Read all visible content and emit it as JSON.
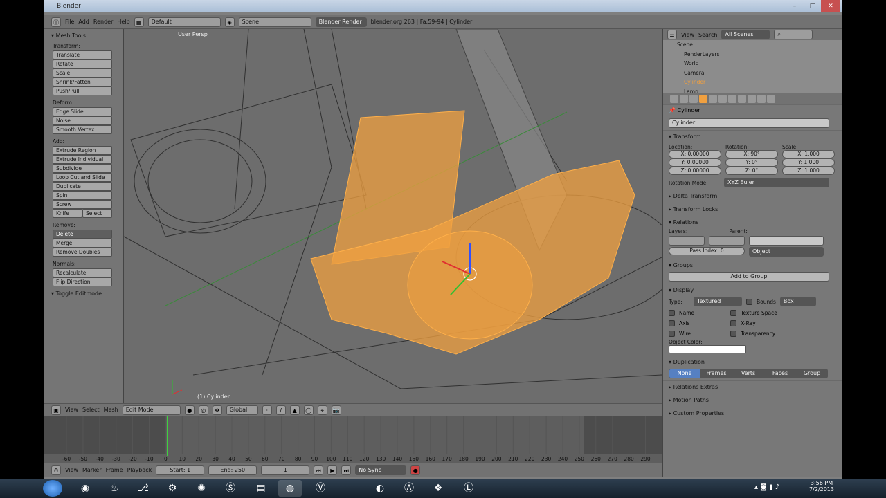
{
  "window": {
    "title": "Blender"
  },
  "infobar": {
    "menus": [
      "File",
      "Add",
      "Render",
      "Help"
    ],
    "layout": "Default",
    "scene": "Scene",
    "engine": "Blender Render",
    "stats": "blender.org 263 | Fa:59-94 | Cylinder"
  },
  "toolshelf": {
    "title": "Mesh Tools",
    "sections": [
      {
        "label": "Transform:",
        "buttons": [
          "Translate",
          "Rotate",
          "Scale",
          "Shrink/Fatten",
          "Push/Pull"
        ]
      },
      {
        "label": "Deform:",
        "buttons": [
          "Edge Slide",
          "Noise",
          "Smooth Vertex"
        ]
      },
      {
        "label": "Add:",
        "buttons": [
          "Extrude Region",
          "Extrude Individual",
          "Subdivide",
          "Loop Cut and Slide",
          "Duplicate",
          "Spin",
          "Screw"
        ]
      },
      {
        "label": "Remove:",
        "buttons": [
          "Delete",
          "Merge",
          "Remove Doubles"
        ]
      },
      {
        "label": "Normals:",
        "buttons": [
          "Recalculate",
          "Flip Direction"
        ]
      }
    ],
    "knife": "Knife",
    "select": "Select",
    "toggle": "Toggle Editmode"
  },
  "viewport": {
    "label": "User Persp",
    "object_label": "(1) Cylinder"
  },
  "view3d_header": {
    "menus": [
      "View",
      "Select",
      "Mesh"
    ],
    "mode": "Edit Mode",
    "orientation": "Global"
  },
  "timeline": {
    "ticks": [
      "-60",
      "-50",
      "-40",
      "-30",
      "-20",
      "-10",
      "0",
      "10",
      "20",
      "30",
      "40",
      "50",
      "60",
      "70",
      "80",
      "90",
      "100",
      "110",
      "120",
      "130",
      "140",
      "150",
      "160",
      "170",
      "180",
      "190",
      "200",
      "210",
      "220",
      "230",
      "240",
      "250",
      "260",
      "270",
      "280",
      "290"
    ],
    "current_frame": 0
  },
  "timeline_header": {
    "menus": [
      "View",
      "Marker",
      "Frame",
      "Playback"
    ],
    "start": "Start: 1",
    "end": "End: 250",
    "frame": "1",
    "sync": "No Sync"
  },
  "outliner": {
    "menus": [
      "View",
      "Search"
    ],
    "filter": "All Scenes",
    "items": [
      "Scene",
      "RenderLayers",
      "World",
      "Camera",
      "Cylinder",
      "Lamp"
    ]
  },
  "properties": {
    "object_path": "Cylinder",
    "object_name": "Cylinder",
    "transform": {
      "title": "Transform",
      "location_label": "Location:",
      "rotation_label": "Rotation:",
      "scale_label": "Scale:",
      "location": [
        "X: 0.00000",
        "Y: 0.00000",
        "Z: 0.00000"
      ],
      "rotation": [
        "X: 90°",
        "Y: 0°",
        "Z: 0°"
      ],
      "scale": [
        "X: 1.000",
        "Y: 1.000",
        "Z: 1.000"
      ],
      "rotation_mode_label": "Rotation Mode:",
      "rotation_mode": "XYZ Euler"
    },
    "delta": "Delta Transform",
    "locks": "Transform Locks",
    "relations": {
      "title": "Relations",
      "layers": "Layers:",
      "parent": "Parent:",
      "parent_type": "Object",
      "pass_index": "Pass Index: 0"
    },
    "groups": {
      "title": "Groups",
      "add": "Add to Group"
    },
    "display": {
      "title": "Display",
      "type_label": "Type:",
      "type": "Textured",
      "bounds": "Bounds",
      "bounds_type": "Box",
      "checks_left": [
        "Name",
        "Axis",
        "Wire"
      ],
      "checks_right": [
        "Texture Space",
        "X-Ray",
        "Transparency"
      ],
      "object_color": "Object Color:"
    },
    "duplication": {
      "title": "Duplication",
      "options": [
        "None",
        "Frames",
        "Verts",
        "Faces",
        "Group"
      ]
    },
    "collapsed": [
      "Relations Extras",
      "Motion Paths",
      "Custom Properties"
    ]
  },
  "taskbar": {
    "time": "3:56 PM",
    "date": "7/2/2013"
  },
  "colors": {
    "selection": "#f0a040",
    "bg": "#6d6d6d"
  }
}
